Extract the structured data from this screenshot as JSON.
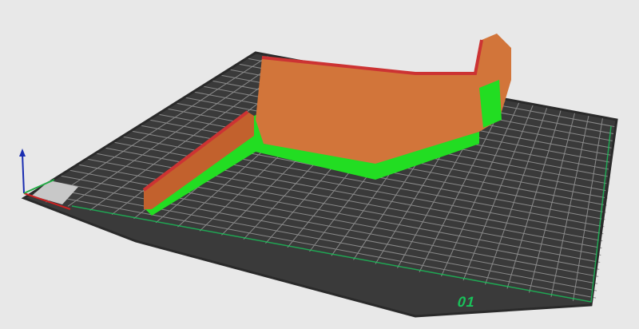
{
  "viewport": {
    "plate_number": "01",
    "colors": {
      "background": "#e8e8e8",
      "plate": "#3a3a3a",
      "grid": "#8a8a8a",
      "plate_border": "#19c25a",
      "model_wall": "#d2753a",
      "model_top": "#cc3333",
      "support_base": "#22dd22",
      "axis_x": "#cc2222",
      "axis_y": "#22aa44",
      "axis_z": "#1a2db0"
    }
  }
}
